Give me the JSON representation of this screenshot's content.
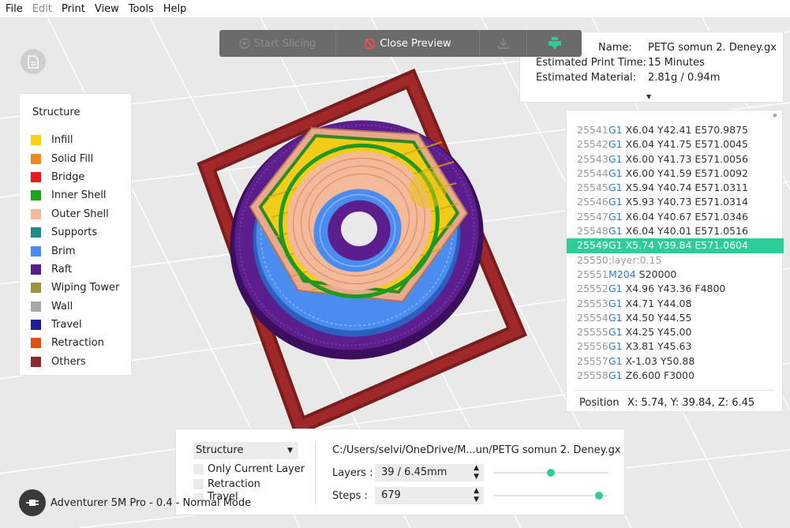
{
  "menu": {
    "items": [
      {
        "label": "File",
        "enabled": true
      },
      {
        "label": "Edit",
        "enabled": false
      },
      {
        "label": "Print",
        "enabled": true
      },
      {
        "label": "View",
        "enabled": true
      },
      {
        "label": "Tools",
        "enabled": true
      },
      {
        "label": "Help",
        "enabled": true
      }
    ]
  },
  "toolbar": {
    "start_slicing": "Start Slicing",
    "close_preview": "Close Preview"
  },
  "info": {
    "name_label": "Name:",
    "name_value": "PETG somun 2. Deney.gx",
    "time_label": "Estimated Print Time:",
    "time_value": "15 Minutes",
    "material_label": "Estimated Material:",
    "material_value": "2.81g / 0.94m"
  },
  "legend": {
    "title": "Structure",
    "items": [
      {
        "label": "Infill",
        "color": "#f7d117"
      },
      {
        "label": "Solid Fill",
        "color": "#f08a1c"
      },
      {
        "label": "Bridge",
        "color": "#e51b1b"
      },
      {
        "label": "Inner Shell",
        "color": "#1ea31e"
      },
      {
        "label": "Outer Shell",
        "color": "#f2b99b"
      },
      {
        "label": "Supports",
        "color": "#1f8a8a"
      },
      {
        "label": "Brim",
        "color": "#4a8cf0"
      },
      {
        "label": "Raft",
        "color": "#5c1a8c"
      },
      {
        "label": "Wiping Tower",
        "color": "#9e9440"
      },
      {
        "label": "Wall",
        "color": "#a8a8a8"
      },
      {
        "label": "Travel",
        "color": "#1d1d96"
      },
      {
        "label": "Retraction",
        "color": "#e34f12"
      },
      {
        "label": "Others",
        "color": "#8c2a2a"
      }
    ]
  },
  "gcode": {
    "lines": [
      {
        "num": "25541",
        "cmd": "G1",
        "args": "X6.04 Y42.41 E570.9875",
        "selected": false
      },
      {
        "num": "25542",
        "cmd": "G1",
        "args": "X6.04 Y41.75 E571.0045",
        "selected": false
      },
      {
        "num": "25543",
        "cmd": "G1",
        "args": "X6.00 Y41.73 E571.0056",
        "selected": false
      },
      {
        "num": "25544",
        "cmd": "G1",
        "args": "X6.00 Y41.59 E571.0092",
        "selected": false
      },
      {
        "num": "25545",
        "cmd": "G1",
        "args": "X5.94 Y40.74 E571.0311",
        "selected": false
      },
      {
        "num": "25546",
        "cmd": "G1",
        "args": "X5.93 Y40.73 E571.0314",
        "selected": false
      },
      {
        "num": "25547",
        "cmd": "G1",
        "args": "X6.04 Y40.67 E571.0346",
        "selected": false
      },
      {
        "num": "25548",
        "cmd": "G1",
        "args": "X6.04 Y40.01 E571.0516",
        "selected": false
      },
      {
        "num": "25549",
        "cmd": "G1",
        "args": "X5.74 Y39.84 E571.0604",
        "selected": true
      },
      {
        "num": "25550",
        "cmd": "",
        "args": ";layer:0.15",
        "selected": false,
        "comment": true
      },
      {
        "num": "25551",
        "cmd": "M204",
        "args": "S20000",
        "selected": false
      },
      {
        "num": "25552",
        "cmd": "G1",
        "args": "X4.96 Y43.36 F4800",
        "selected": false
      },
      {
        "num": "25553",
        "cmd": "G1",
        "args": "X4.71 Y44.08",
        "selected": false
      },
      {
        "num": "25554",
        "cmd": "G1",
        "args": "X4.50 Y44.55",
        "selected": false
      },
      {
        "num": "25555",
        "cmd": "G1",
        "args": "X4.25 Y45.00",
        "selected": false
      },
      {
        "num": "25556",
        "cmd": "G1",
        "args": "X3.81 Y45.63",
        "selected": false
      },
      {
        "num": "25557",
        "cmd": "G1",
        "args": "X-1.03 Y50.88",
        "selected": false
      },
      {
        "num": "25558",
        "cmd": "G1",
        "args": "Z6.600 F3000",
        "selected": false
      }
    ],
    "position_label": "Position",
    "position_value": "X: 5.74, Y: 39.84, Z: 6.45"
  },
  "bottom": {
    "view_mode": "Structure",
    "only_current_layer": "Only Current Layer",
    "retraction": "Retraction",
    "travel": "Travel",
    "file_path": "C:/Users/selvi/OneDrive/M...un/PETG somun 2. Deney.gx",
    "layers_label": "Layers :",
    "layers_value": "39 / 6.45mm",
    "layers_fraction": 0.5,
    "steps_label": "Steps :",
    "steps_value": "679",
    "steps_fraction": 0.95
  },
  "status": {
    "printer": "Adventurer 5M Pro - 0.4 - Normal Mode"
  }
}
